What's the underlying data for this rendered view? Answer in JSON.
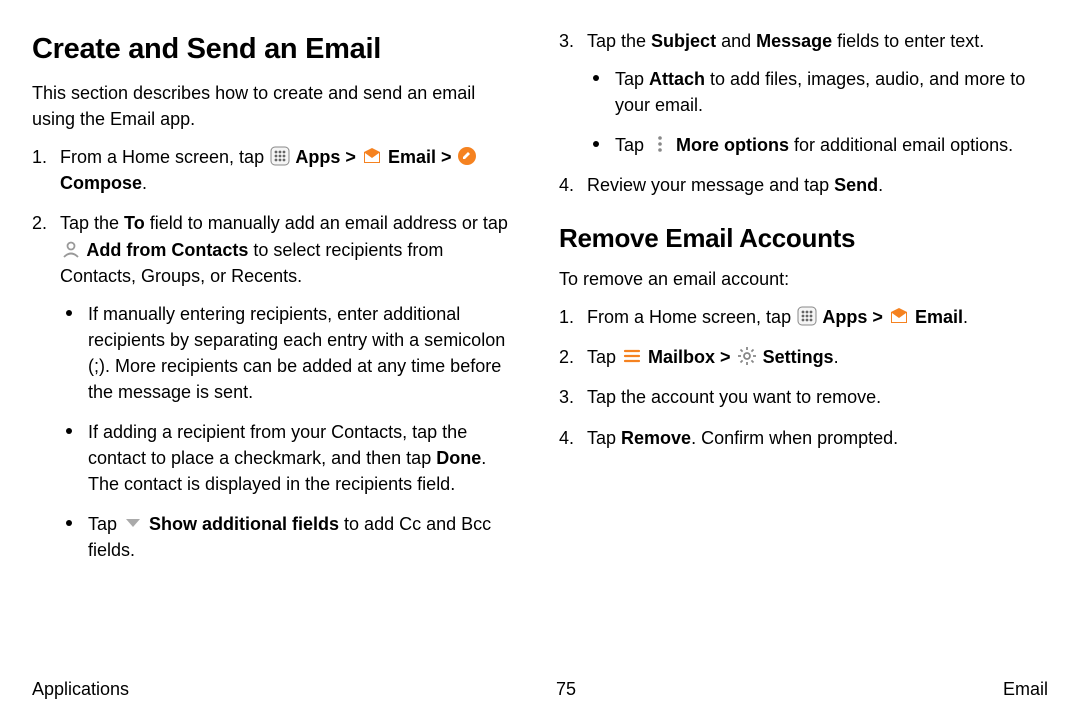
{
  "left": {
    "h1": "Create and Send an Email",
    "intro": "This section describes how to create and send an email using the Email app.",
    "s1a": "From a Home screen, tap ",
    "apps": " Apps",
    "sep": " > ",
    "email": " Email",
    "sep2": " > ",
    "compose": " Compose",
    "dot": ".",
    "s2a": "Tap the ",
    "to": "To",
    "s2b": " field to manually add an email address or tap ",
    "addcontacts": " Add from Contacts",
    "s2c": " to select recipients from Contacts, Groups, or Recents.",
    "b1": "If manually entering recipients, enter additional recipients by separating each entry with a semicolon (;). More recipients can be added at any time before the message is sent.",
    "b2a": "If adding a recipient from your Contacts, tap the contact to place a checkmark, and then tap ",
    "done": "Done",
    "b2b": ". The contact is displayed in the recipients field.",
    "b3a": "Tap ",
    "showfields": " Show additional fields",
    "b3b": " to add Cc and Bcc fields."
  },
  "right": {
    "s3a": "Tap the ",
    "subject": "Subject",
    "and": " and ",
    "message": "Message",
    "s3b": " fields to enter text.",
    "rb1a": "Tap ",
    "attach": "Attach",
    "rb1b": " to add files, images, audio, and more to your email.",
    "rb2a": "Tap ",
    "moreopt": " More options",
    "rb2b": " for additional email options.",
    "s4a": "Review your message and tap ",
    "send": "Send",
    "s4b": ".",
    "h2": "Remove Email Accounts",
    "intro2": "To remove an email account:",
    "r1a": "From a Home screen, tap ",
    "apps": " Apps",
    "sep": " > ",
    "email": " Email",
    "dot": ".",
    "r2a": "Tap ",
    "mailbox": " Mailbox",
    "sep2": " > ",
    "settings": " Settings",
    "dot2": ".",
    "r3": "Tap the account you want to remove.",
    "r4a": "Tap ",
    "remove": "Remove",
    "r4b": ". Confirm when prompted."
  },
  "footer": {
    "left": "Applications",
    "center": "75",
    "right": "Email"
  }
}
